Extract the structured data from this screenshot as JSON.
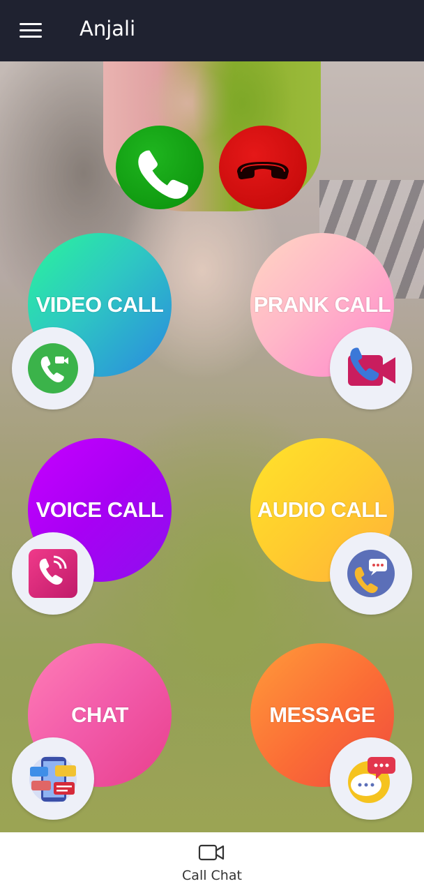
{
  "appbar": {
    "title": "Anjali",
    "menu_icon": "hamburger-menu-icon"
  },
  "incoming_call": {
    "accept_icon": "phone-accept-icon",
    "decline_icon": "phone-decline-icon",
    "accept_color": "#0f9d12",
    "decline_color": "#d10d0d"
  },
  "actions": [
    {
      "label": "VIDEO CALL",
      "icon": "video-call-icon"
    },
    {
      "label": "PRANK CALL",
      "icon": "prank-video-call-icon"
    },
    {
      "label": "VOICE CALL",
      "icon": "voice-call-icon"
    },
    {
      "label": "AUDIO CALL",
      "icon": "audio-call-chat-icon"
    },
    {
      "label": "CHAT",
      "icon": "chat-app-icon"
    },
    {
      "label": "MESSAGE",
      "icon": "message-bubbles-icon"
    }
  ],
  "bottom_nav": {
    "label": "Call Chat",
    "icon": "video-camera-icon"
  },
  "colors": {
    "appbar": "#1f2230",
    "badge_bg": "#eef0f8"
  }
}
